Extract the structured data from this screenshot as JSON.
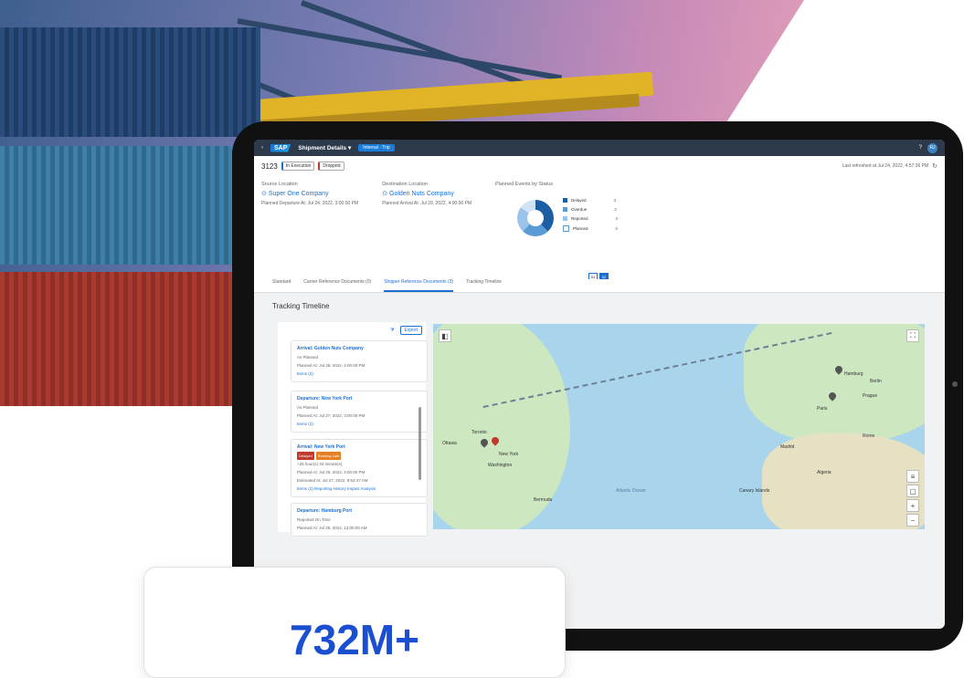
{
  "shell": {
    "logo": "SAP",
    "title": "Shipment Details ▾",
    "pill": "Internal · Trip",
    "avatar": "RJ",
    "help_icon": "help-icon",
    "back_icon": "back-icon"
  },
  "header": {
    "object_id": "3123",
    "status_badges": [
      "In Execution",
      "Dropped"
    ],
    "last_refreshed": "Last refreshed at Jul 24, 2022, 4:57:36 PM",
    "source": {
      "label": "Source Location",
      "name": "Super One Company",
      "sub": "Planned Departure At: Jul 24, 2022, 3:00:00 PM"
    },
    "destination": {
      "label": "Destination Location",
      "name": "Golden Nuts Company",
      "sub": "Planned Arrival At: Jul 29, 2022, 4:00:00 PM"
    },
    "chart_title": "Planned Events by Status",
    "legend": [
      {
        "label": "Delayed",
        "value": "3",
        "color": "#1b5ea3"
      },
      {
        "label": "Overdue",
        "value": "2",
        "color": "#5b9bd5"
      },
      {
        "label": "Reported",
        "value": "3",
        "color": "#9cc4ea"
      },
      {
        "label": "Planned",
        "value": "0",
        "color": "#d0e4f6"
      }
    ],
    "pager": [
      "01",
      "02"
    ]
  },
  "tabs": [
    "Standard",
    "Carrier Reference Documents (0)",
    "Shipper Reference Documents (3)",
    "Tracking Timeline"
  ],
  "section_title": "Tracking Timeline",
  "timeline": {
    "export_label": "Export",
    "events": [
      {
        "title": "Arrival: Golden Nuts Company",
        "status": "As Planned",
        "planned": "Planned At: Jul 28, 2022, 4:00:00 PM",
        "links": "Items (2)"
      },
      {
        "title": "Departure: New York Port",
        "status": "As Planned",
        "planned": "Planned At: Jul 27, 2022, 3:00:00 PM",
        "links": "Items (2)"
      },
      {
        "title": "Arrival: New York Port",
        "chips": [
          "Delayed",
          "Running Late"
        ],
        "status": "+25 hour(s) 34 minute(s)",
        "planned": "Planned At: Jul 26, 2022, 4:00:00 PM",
        "estimated": "Estimated At: Jul 27, 2022, 9:53:47 AM",
        "links": "Items (2)   Reporting History   Impact Analysis"
      },
      {
        "title": "Departure: Hamburg Port",
        "status": "Reported On Time",
        "planned": "Planned At: Jul 25, 2022, 12:00:00 AM",
        "links": ""
      }
    ]
  },
  "map": {
    "labels": [
      "Ottawa",
      "Toronto",
      "New York",
      "Washington",
      "Bermuda",
      "Hamburg",
      "Berlin",
      "Prague",
      "Paris",
      "Madrid",
      "Rome",
      "Algeria",
      "Canary Islands",
      "Atlantic Ocean"
    ]
  },
  "stat": {
    "value": "732M+"
  }
}
